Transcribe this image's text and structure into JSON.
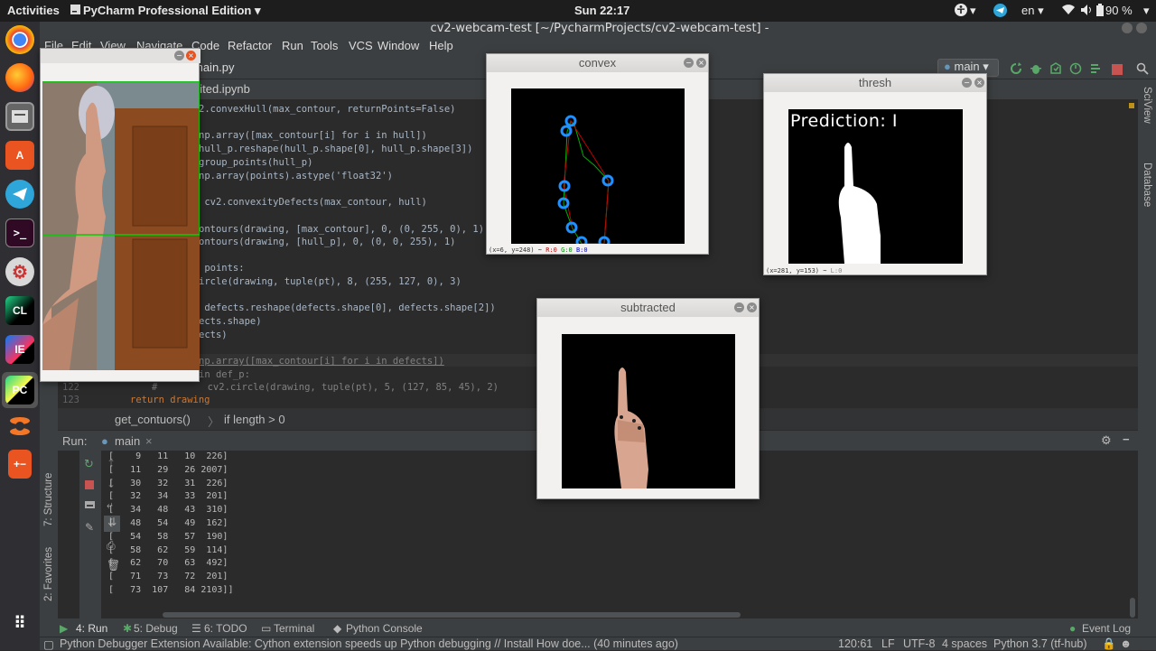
{
  "topbar": {
    "activities": "Activities",
    "app_menu": "PyCharm Professional Edition ▾",
    "clock": "Sun 22:17",
    "language": "en ▾",
    "battery": "90 %"
  },
  "window": {
    "title": "cv2-webcam-test [~/PycharmProjects/cv2-webcam-test] - …/main.py"
  },
  "menu": [
    "File",
    "Edit",
    "View",
    "Navigate",
    "Code",
    "Refactor",
    "Run",
    "Tools",
    "VCS",
    "Window",
    "Help"
  ],
  "navbar": {
    "file_tab": "main.py",
    "run_config": "main ▾"
  },
  "tabs": {
    "notebook_tab": "nited.ipynb"
  },
  "code_lines": [
    "2.convexHull(max_contour, returnPoints=False)",
    "",
    "np.array([max_contour[i] for i in hull])",
    "hull_p.reshape(hull_p.shape[0], hull_p.shape[3])",
    "group_points(hull_p)",
    "np.array(points).astype('float32')",
    "",
    " cv2.convexityDefects(max_contour, hull)",
    "",
    "ontours(drawing, [max_contour], 0, (0, 255, 0), 1)",
    "ontours(drawing, [hull_p], 0, (0, 0, 255), 1)",
    "",
    " points:",
    "ircle(drawing, tuple(pt), 8, (255, 127, 0), 3)",
    "",
    " defects.reshape(defects.shape[0], defects.shape[2])",
    "ects.shape)",
    "ects)",
    "",
    "np.array([max_contour[i] for i in defects])",
    "in def_p:",
    "     cv2.circle(drawing, tuple(pt), 5, (127, 85, 45), 2)",
    "return drawing"
  ],
  "line_numbers": [
    "122",
    "123"
  ],
  "code_hash": "#",
  "breadcrumb": {
    "fn": "get_contuors()",
    "sep": "〉",
    "cond": "if length > 0"
  },
  "run": {
    "label": "Run:",
    "config": "main",
    "close": "×",
    "output": [
      "[    9   11   10  226]",
      "[   11   29   26 2007]",
      "[   30   32   31  226]",
      "[   32   34   33  201]",
      "[   34   48   43  310]",
      "[   48   54   49  162]",
      "[   54   58   57  190]",
      "[   58   62   59  114]",
      "[   62   70   63  492]",
      "[   71   73   72  201]",
      "[   73  107   84 2103]]"
    ]
  },
  "side_tabs": {
    "structure": "7: Structure",
    "favorites": "2: Favorites",
    "sciview": "SciView",
    "database": "Database"
  },
  "bottom_tools": [
    "4: Run",
    "5: Debug",
    "6: TODO",
    "Terminal",
    "Python Console"
  ],
  "event_log": "Event Log",
  "status": {
    "message": "Python Debugger Extension Available: Cython extension speeds up Python debugging // Install   How doe... (40 minutes ago)",
    "position": "120:61",
    "line_sep": "LF",
    "encoding": "UTF-8",
    "indent": "4 spaces",
    "interpreter": "Python 3.7 (tf-hub)"
  },
  "cv_windows": {
    "convex": {
      "title": "convex",
      "status": "(x=6, y=248) ~ ",
      "r": "R:0",
      "g": "G:0",
      "b": "B:0"
    },
    "thresh": {
      "title": "thresh",
      "prediction": "Prediction: I",
      "status": "(x=281, y=153) ~ ",
      "l": "L:0"
    },
    "subtracted": {
      "title": "subtracted"
    }
  },
  "colors": {
    "ide_bg": "#2b2b2b",
    "ide_panel": "#3c3f41",
    "keyword": "#cc7832",
    "string": "#6a8759",
    "number": "#6897bb",
    "contour_green": "#00c000",
    "circle_blue": "#1e90ff"
  }
}
